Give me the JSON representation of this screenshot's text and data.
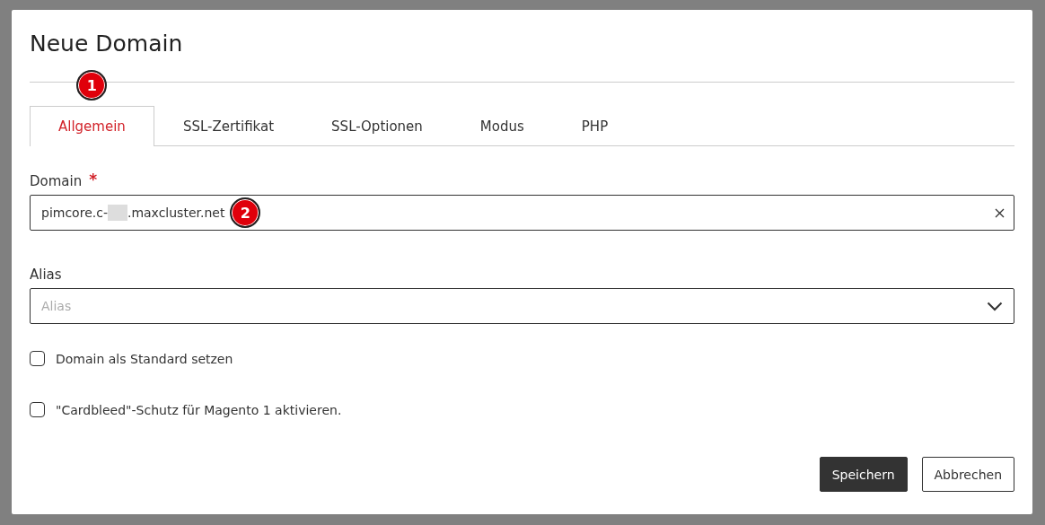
{
  "dialog": {
    "title": "Neue Domain"
  },
  "tabs": [
    {
      "label": "Allgemein",
      "selected": true,
      "callout": "1"
    },
    {
      "label": "SSL-Zertifikat",
      "selected": false
    },
    {
      "label": "SSL-Optionen",
      "selected": false
    },
    {
      "label": "Modus",
      "selected": false
    },
    {
      "label": "PHP",
      "selected": false
    }
  ],
  "domain": {
    "label": "Domain",
    "required_mark": "*",
    "value_start": "pimcore.c-",
    "value_end": ".maxcluster.net",
    "redacted": true,
    "callout": "2"
  },
  "alias": {
    "label": "Alias",
    "placeholder": "Alias"
  },
  "checkboxes": [
    {
      "label": "Domain als Standard setzen",
      "checked": false
    },
    {
      "label": "\"Cardbleed\"-Schutz für Magento 1 aktivieren.",
      "checked": false
    }
  ],
  "buttons": [
    {
      "label": "Speichern",
      "kind": "primary"
    },
    {
      "label": "Abbrechen",
      "kind": "secondary"
    }
  ]
}
